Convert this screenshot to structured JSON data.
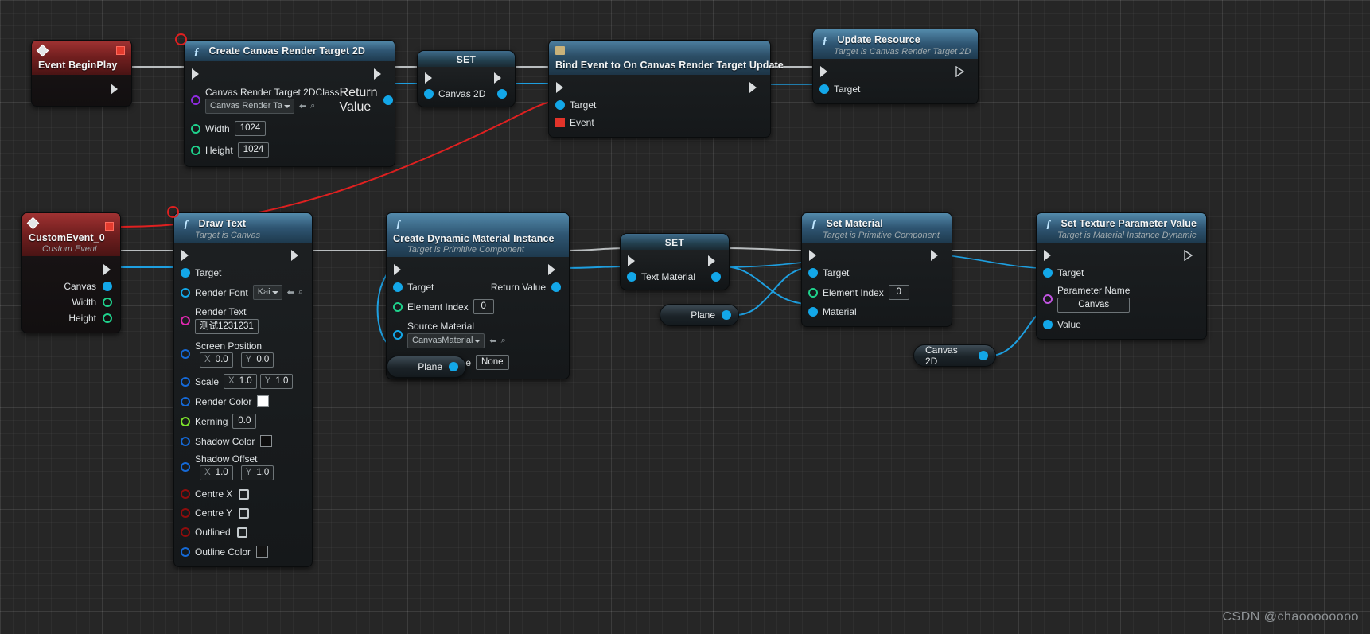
{
  "watermark": "CSDN @chaoooooooo",
  "nodes": {
    "event_begin_play": {
      "title": "Event BeginPlay",
      "icon": "event-diamond-icon"
    },
    "create_canvas_rt": {
      "title": "Create Canvas Render Target 2D",
      "icon": "function-icon",
      "inputs": {
        "class_label": "Canvas Render Target 2DClass",
        "class_value": "Canvas Render Ta",
        "width_label": "Width",
        "width_value": "1024",
        "height_label": "Height",
        "height_value": "1024"
      },
      "outputs": {
        "return_label": "Return Value"
      }
    },
    "set_canvas_2d": {
      "title": "SET",
      "var_label": "Canvas 2D"
    },
    "bind_event": {
      "title": "Bind Event to On Canvas Render Target Update",
      "icon": "delegate-icon",
      "inputs": {
        "target_label": "Target",
        "event_label": "Event"
      }
    },
    "update_resource": {
      "title": "Update Resource",
      "subtitle": "Target is Canvas Render Target 2D",
      "icon": "function-icon",
      "inputs": {
        "target_label": "Target"
      }
    },
    "custom_event": {
      "title": "CustomEvent_0",
      "subtitle": "Custom Event",
      "icon": "event-diamond-icon",
      "outputs": {
        "canvas_label": "Canvas",
        "width_label": "Width",
        "height_label": "Height"
      }
    },
    "draw_text": {
      "title": "Draw Text",
      "subtitle": "Target is Canvas",
      "icon": "function-icon",
      "inputs": {
        "target_label": "Target",
        "render_font_label": "Render Font",
        "render_font_value": "Kai",
        "render_text_label": "Render Text",
        "render_text_value": "测试1231231",
        "screen_position_label": "Screen Position",
        "screen_position_x": "0.0",
        "screen_position_y": "0.0",
        "scale_label": "Scale",
        "scale_x": "1.0",
        "scale_y": "1.0",
        "render_color_label": "Render Color",
        "render_color_value": "#ffffff",
        "kerning_label": "Kerning",
        "kerning_value": "0.0",
        "shadow_color_label": "Shadow Color",
        "shadow_color_value": "#000000",
        "shadow_offset_label": "Shadow Offset",
        "shadow_offset_x": "1.0",
        "shadow_offset_y": "1.0",
        "centre_x_label": "Centre X",
        "centre_y_label": "Centre Y",
        "outlined_label": "Outlined",
        "outline_color_label": "Outline Color",
        "outline_color_value": "#111111"
      }
    },
    "create_dyn_mat": {
      "title": "Create Dynamic Material Instance",
      "subtitle": "Target is Primitive Component",
      "icon": "function-icon",
      "inputs": {
        "target_label": "Target",
        "element_index_label": "Element Index",
        "element_index_value": "0",
        "source_material_label": "Source Material",
        "source_material_value": "CanvasMaterial",
        "optional_name_label": "Optional Name",
        "optional_name_value": "None"
      },
      "outputs": {
        "return_label": "Return Value"
      }
    },
    "set_text_material": {
      "title": "SET",
      "var_label": "Text Material"
    },
    "set_material": {
      "title": "Set Material",
      "subtitle": "Target is Primitive Component",
      "icon": "function-icon",
      "inputs": {
        "target_label": "Target",
        "element_index_label": "Element Index",
        "element_index_value": "0",
        "material_label": "Material"
      }
    },
    "set_texture_param": {
      "title": "Set Texture Parameter Value",
      "subtitle": "Target is Material Instance Dynamic",
      "icon": "function-icon",
      "inputs": {
        "target_label": "Target",
        "parameter_name_label": "Parameter Name",
        "parameter_name_value": "Canvas",
        "value_label": "Value"
      }
    },
    "plane_var_1": {
      "label": "Plane"
    },
    "plane_var_2": {
      "label": "Plane"
    },
    "canvas2d_var": {
      "label": "Canvas 2D"
    }
  },
  "colors": {
    "exec": "#d9dcde",
    "object": "#13a7e8",
    "class": "#8f2be0",
    "int": "#1fd18c",
    "float": "#7ee32a",
    "struct": "#1569d6",
    "bool": "#8f0d0d",
    "name": "#e028b0",
    "delegate": "#e3342a",
    "wire_white": "#b9bdbf",
    "wire_blue": "#1e9fe0",
    "wire_red": "#e02020"
  }
}
